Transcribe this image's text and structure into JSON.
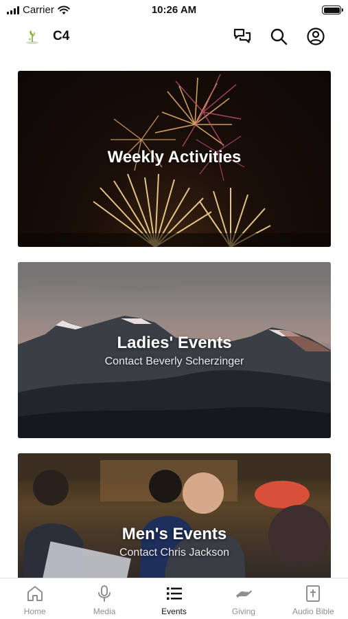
{
  "status_bar": {
    "carrier": "Carrier",
    "time": "10:26 AM"
  },
  "header": {
    "title": "C4"
  },
  "cards": [
    {
      "title": "Weekly Activities",
      "subtitle": ""
    },
    {
      "title": "Ladies' Events",
      "subtitle": "Contact Beverly Scherzinger"
    },
    {
      "title": "Men's Events",
      "subtitle": "Contact Chris Jackson"
    }
  ],
  "tabs": [
    {
      "label": "Home",
      "icon": "home-icon",
      "active": false
    },
    {
      "label": "Media",
      "icon": "microphone-icon",
      "active": false
    },
    {
      "label": "Events",
      "icon": "list-icon",
      "active": true
    },
    {
      "label": "Giving",
      "icon": "hand-icon",
      "active": false
    },
    {
      "label": "Audio Bible",
      "icon": "bible-icon",
      "active": false
    }
  ],
  "colors": {
    "active_tab": "#111111",
    "inactive_tab": "#8e8e8e",
    "accent_logo": "#7fb13a"
  }
}
